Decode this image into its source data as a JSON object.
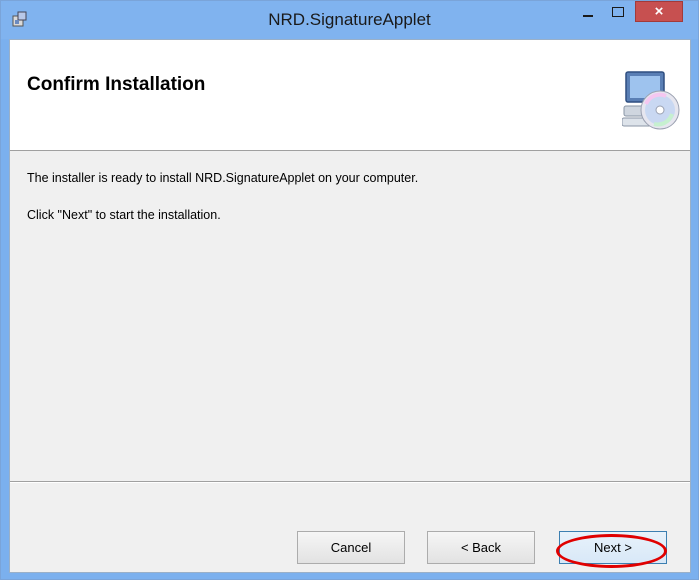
{
  "window": {
    "title": "NRD.SignatureApplet",
    "controls": {
      "minimize": "minimize-icon",
      "maximize": "maximize-icon",
      "close_glyph": "×"
    },
    "colors": {
      "title_bar": "#80b3ef",
      "close_button": "#c75050",
      "highlight": "#e00000"
    }
  },
  "header": {
    "title": "Confirm Installation",
    "graphic": "computer-cd-icon"
  },
  "body": {
    "line1": "The installer is ready to install NRD.SignatureApplet on your computer.",
    "line2": "Click \"Next\" to start the installation."
  },
  "footer": {
    "cancel_label": "Cancel",
    "back_label": "< Back",
    "next_label": "Next >"
  }
}
